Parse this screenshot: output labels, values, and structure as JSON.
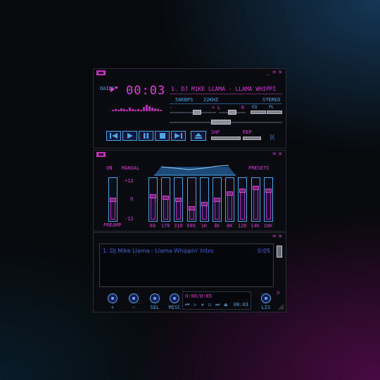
{
  "colors": {
    "accent": "#e23ce0",
    "blue": "#4aa6e6",
    "playlist_text": "#3f63d8",
    "window_bg": "#0a0b10"
  },
  "main": {
    "visualizer_label": "OAIDV",
    "time": "00:03",
    "song_title": "1. DJ MIKE LLAMA - LLAMA WHIPPI",
    "kbps": "56KBPS",
    "khz": "22KHZ",
    "stereo": "STEREO",
    "volume_minus": "-",
    "volume_plus": "+",
    "balance_l": "L",
    "balance_r": "R",
    "eq_toggle": "EQ",
    "pl_toggle": "PL",
    "shuffle": "SHF",
    "repeat": "REP",
    "logo_glyph": "ᛞ",
    "volume_level": 0.62,
    "balance_level": 0.5,
    "seek_level": 0.45
  },
  "equalizer": {
    "on_label": "ON",
    "auto_label": "MANUAL",
    "presets_label": "PRESETS",
    "db_plus": "+12",
    "db_zero": "0",
    "db_minus": "-12",
    "preamp_label": "PREAMP",
    "bands": [
      "60",
      "170",
      "310",
      "600",
      "1K",
      "3K",
      "6K",
      "12K",
      "14K",
      "16K"
    ],
    "band_levels_db": [
      2,
      1,
      0,
      -6,
      -3,
      0,
      4,
      6,
      8,
      6
    ],
    "preamp_db": 0
  },
  "playlist": {
    "items": [
      {
        "title": "1. DJ Mike Llama - Llama Whippin' Intro",
        "duration": "0:05"
      }
    ],
    "add_label": "+",
    "rem_label": "−",
    "sel_label": "SEL",
    "misc_label": "MISC",
    "list_label": "LIS",
    "mini_time": "0:00/0:05",
    "mini_controls": "⏮ ▷ ⏸ ◻ ⏭ ⏏",
    "mini_elapsed": "00:03"
  }
}
